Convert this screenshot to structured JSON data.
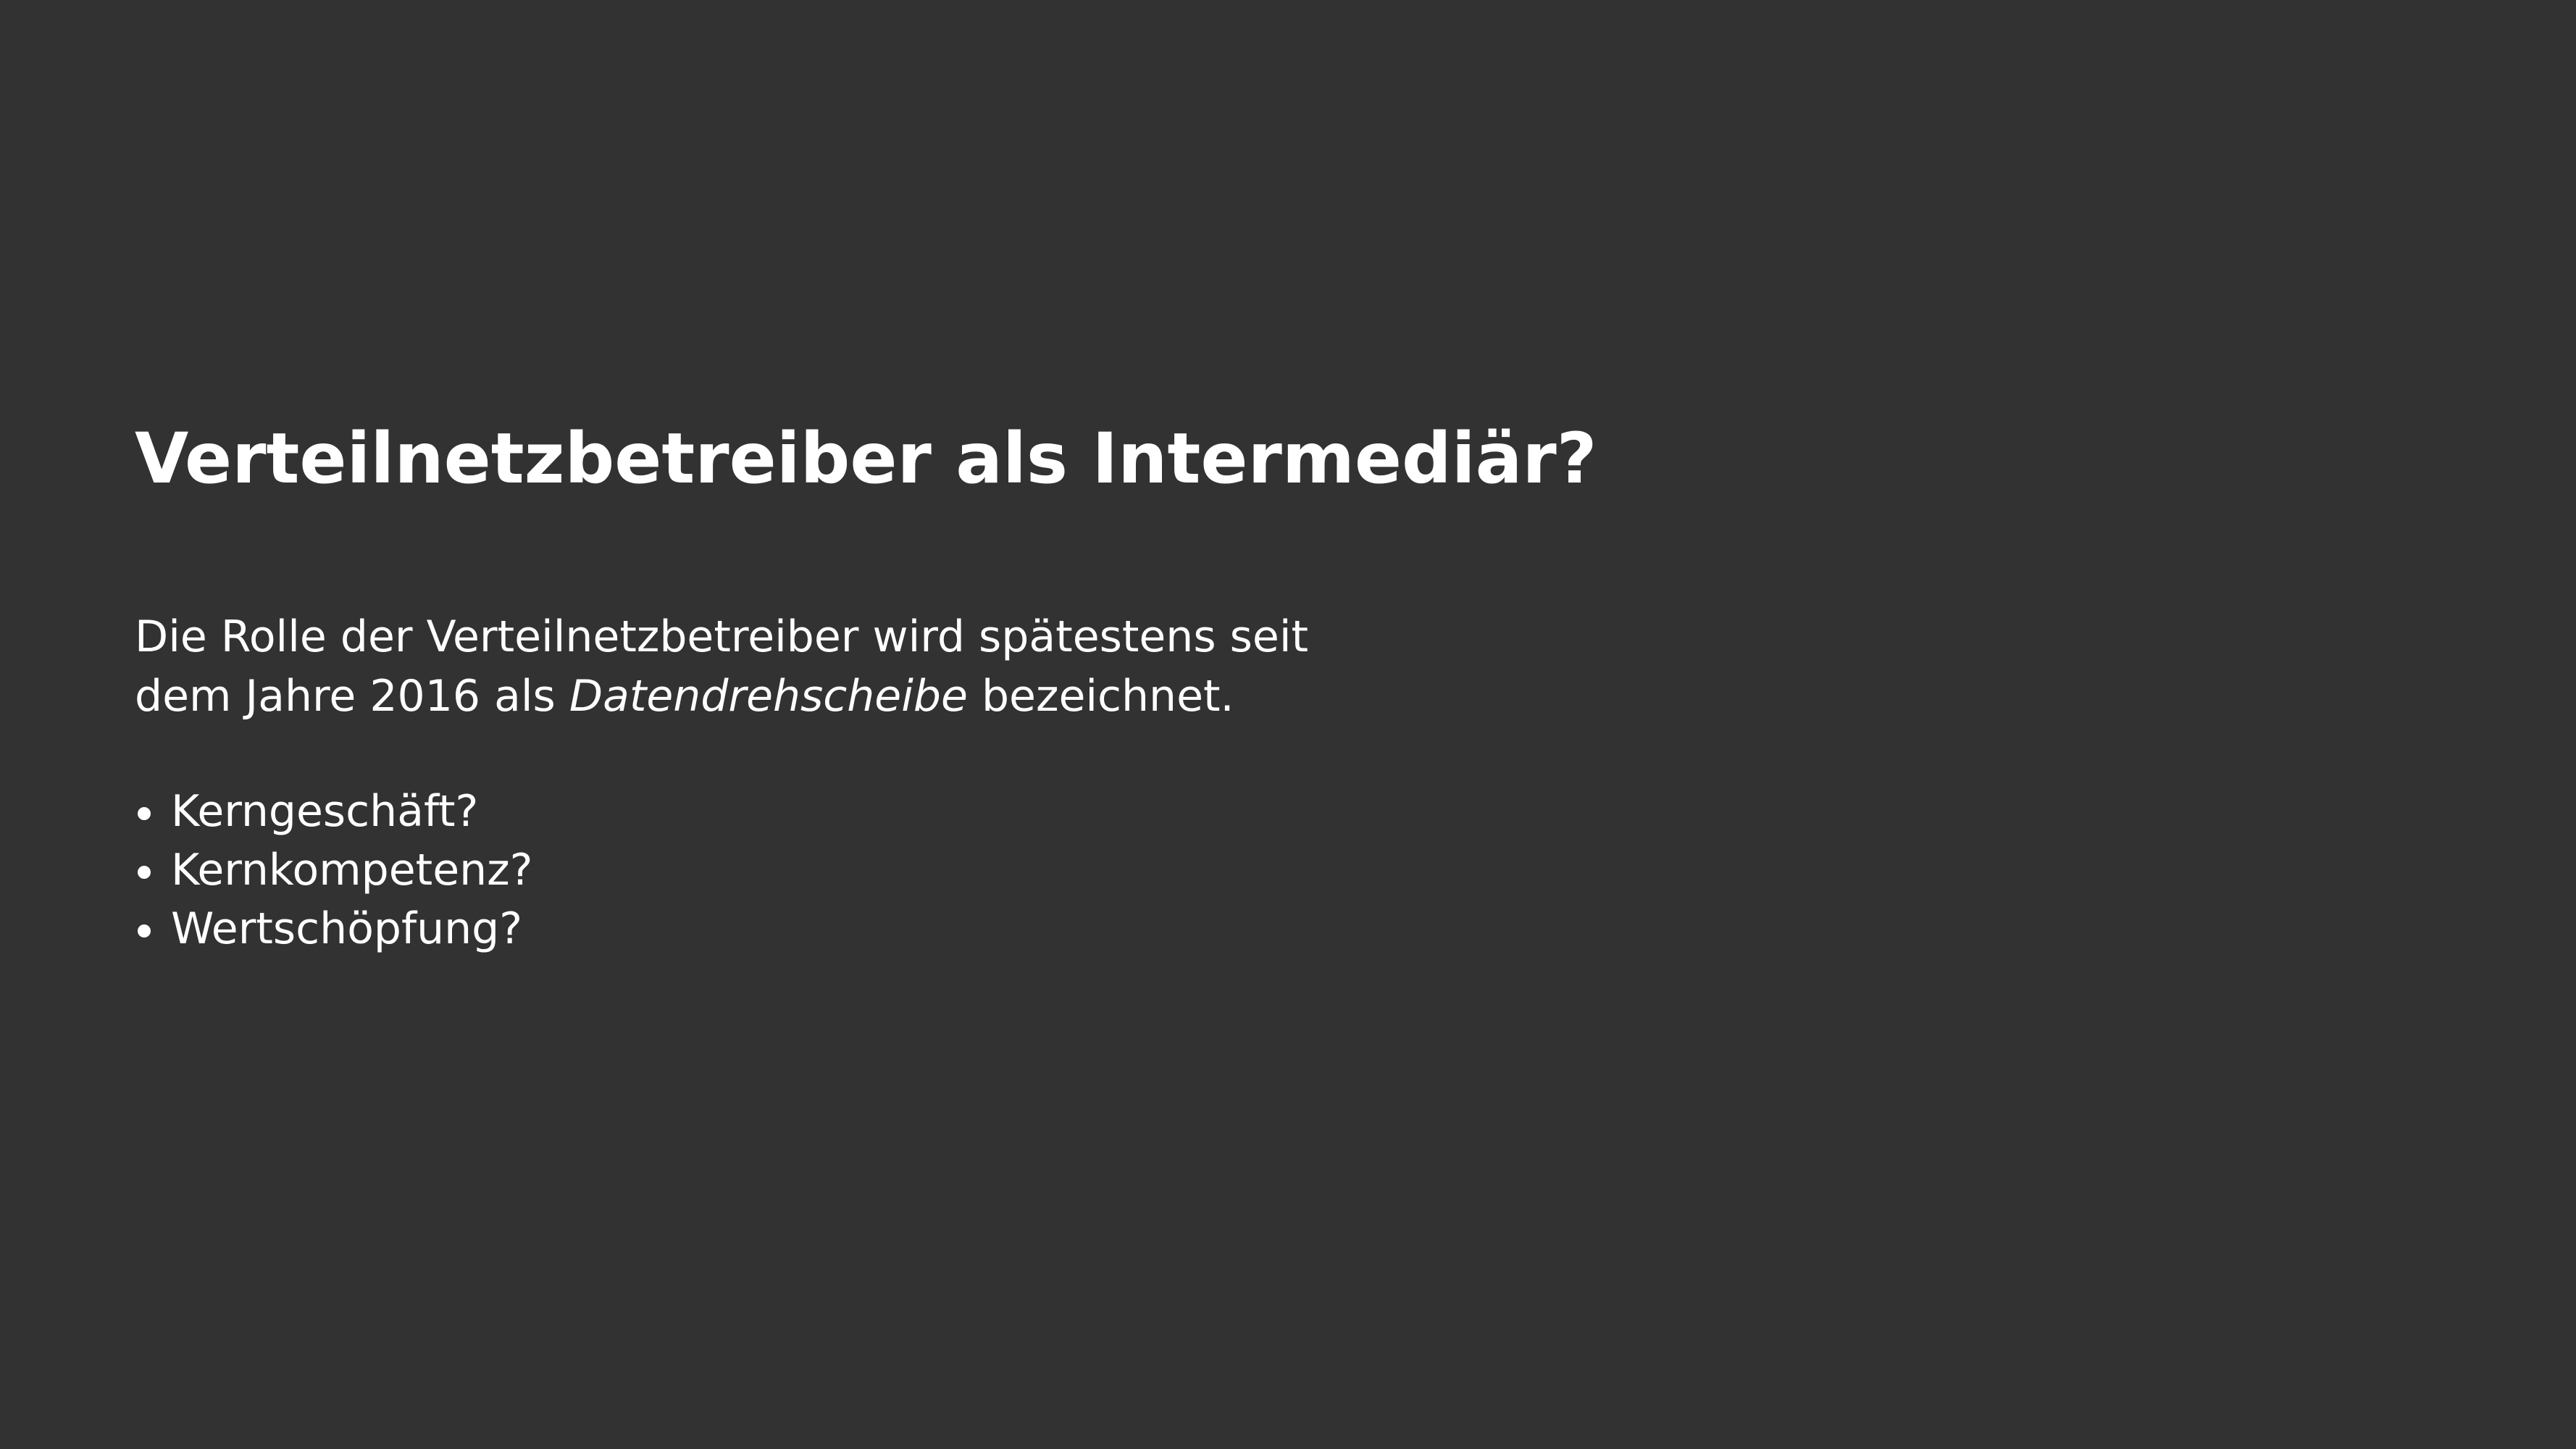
{
  "slide": {
    "title": "Verteilnetzbetreiber als Intermediär?",
    "paragraph": {
      "line1": "Die Rolle der Verteilnetzbetreiber wird spätestens seit",
      "line2_before": "dem Jahre 2016 als ",
      "line2_emphasis": "Datendrehscheibe",
      "line2_after": " bezeichnet."
    },
    "bullets": [
      {
        "label": "Kerngeschäft?"
      },
      {
        "label": "Kernkompetenz?"
      },
      {
        "label": "Wertschöpfung?"
      }
    ]
  },
  "colors": {
    "background": "#323232",
    "text": "#ffffff"
  }
}
